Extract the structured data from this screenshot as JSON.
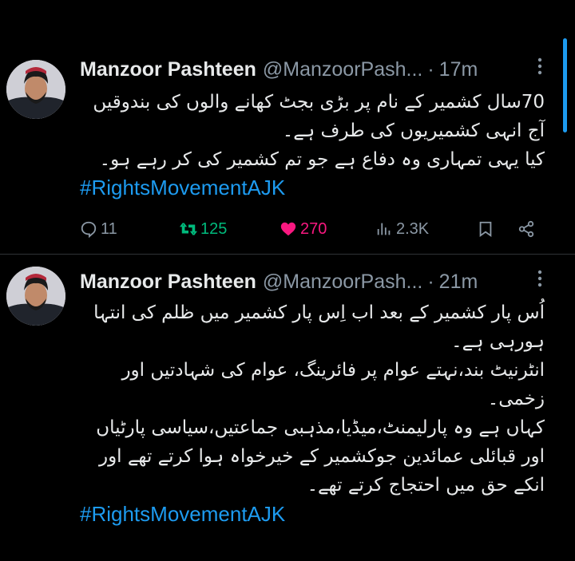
{
  "tweets": [
    {
      "author_name": "Manzoor Pashteen",
      "handle": "@ManzoorPash...",
      "separator": "·",
      "time": "17m",
      "more_icon": "more-vertical-icon",
      "lines": [
        "70سال کشمیر کے نام پر بڑی بجٹ کھانے والوں کی بندوقیں",
        "آج انہی کشمیریوں کی طرف ہے۔",
        "کیا یہی تمہاری وہ دفاع ہے جو تم کشمیر کی کر رہے ہو۔"
      ],
      "hashtag": "#RightsMovementAJK",
      "stats": {
        "replies": "11",
        "retweets": "125",
        "likes": "270",
        "views": "2.3K"
      }
    },
    {
      "author_name": "Manzoor Pashteen",
      "handle": "@ManzoorPash...",
      "separator": "·",
      "time": "21m",
      "more_icon": "more-vertical-icon",
      "lines": [
        "اُس پار کشمیر کے بعد اب اِس پار کشمیر میں ظلم کی انتہا",
        "ہورہی ہے۔",
        "انٹرنیٹ بند،نہتے عوام پر فائرینگ، عوام کی شہادتیں اور",
        "زخمی۔",
        "کہاں ہے وہ پارلیمنٹ،میڈیا،مذہبی جماعتیں،سیاسی پارٹیاں",
        "اور قبائلی عمائدین جوکشمیر کے خیرخواہ ہوا کرتے تھے اور",
        "انکے حق میں احتجاج کرتے تھے۔"
      ],
      "hashtag": "#RightsMovementAJK"
    }
  ],
  "colors": {
    "background": "#000000",
    "text": "#e7e9ea",
    "muted": "#8b98a5",
    "link": "#1d9bf0",
    "retweet": "#00ba7c",
    "like": "#f91880"
  }
}
